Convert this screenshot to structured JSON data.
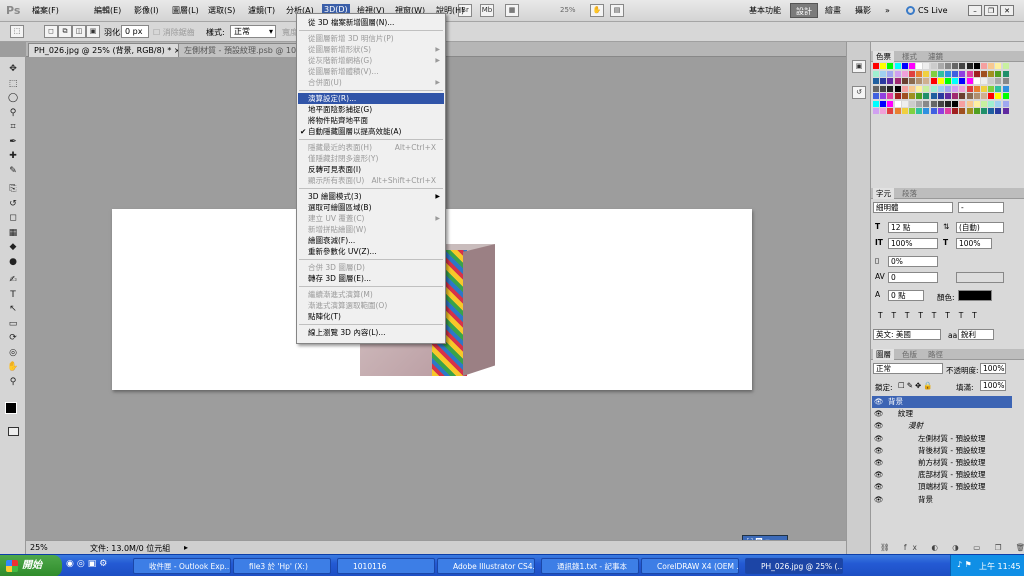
{
  "app": {
    "logo": "Ps"
  },
  "menubar": {
    "items": [
      "檔案(F)",
      "編輯(E)",
      "影像(I)",
      "圖層(L)",
      "選取(S)",
      "濾鏡(T)",
      "分析(A)",
      "3D(D)",
      "檢視(V)",
      "視窗(W)",
      "說明(H)"
    ],
    "active": "3D(D)",
    "toolbar_icons": [
      "Br",
      "Mb"
    ],
    "zoom": "25%",
    "workspaces": [
      "基本功能",
      "設計",
      "繪畫",
      "攝影"
    ],
    "workspace_selected": "設計",
    "more": "»",
    "cslive": "CS Live"
  },
  "options": {
    "feather_label": "羽化:",
    "feather_value": "0 px",
    "antialias_label": "消除鋸齒",
    "style_label": "樣式:",
    "style_value": "正常",
    "width_label": "寬度:"
  },
  "tabs": [
    {
      "label": "PH_026.jpg @ 25% (背景, RGB/8) *"
    },
    {
      "label": "左側材質 - 預設紋理.psb @ 10..."
    }
  ],
  "tab_close": "×",
  "tools": [
    "move-tool",
    "marquee-tool",
    "lasso-tool",
    "quick-select-tool",
    "crop-tool",
    "eyedropper-tool",
    "healing-tool",
    "brush-tool",
    "clone-tool",
    "history-brush-tool",
    "eraser-tool",
    "gradient-tool",
    "blur-tool",
    "dodge-tool",
    "pen-tool",
    "type-tool",
    "path-select-tool",
    "shape-tool",
    "3d-rotate-tool",
    "3d-orbit-tool",
    "hand-tool",
    "zoom-tool"
  ],
  "tool_glyphs": [
    "✥",
    "⬚",
    "◯",
    "⚲",
    "⌗",
    "✒",
    "✚",
    "✎",
    "⎘",
    "↺",
    "◻",
    "▦",
    "◆",
    "●",
    "✍",
    "T",
    "↖",
    "▭",
    "⟳",
    "◎",
    "✋",
    "⚲"
  ],
  "status": {
    "zoom": "25%",
    "doc": "文件: 13.0M/0 位元組"
  },
  "menu_3d": [
    {
      "label": "從 3D 檔案新增圖層(N)...",
      "enabled": true
    },
    {
      "sep": true
    },
    {
      "label": "從圖層新增 3D 明信片(P)",
      "enabled": false
    },
    {
      "label": "從圖層新增形狀(S)",
      "enabled": false,
      "submenu": true
    },
    {
      "label": "從灰階新增網格(G)",
      "enabled": false,
      "submenu": true
    },
    {
      "label": "從圖層新增體積(V)...",
      "enabled": false
    },
    {
      "label": "合併面(U)",
      "enabled": false,
      "submenu": true
    },
    {
      "sep": true
    },
    {
      "label": "演算設定(R)...",
      "enabled": true,
      "highlighted": true
    },
    {
      "label": "地平面陰影捕捉(G)",
      "enabled": true
    },
    {
      "label": "將物件貼齊地平面",
      "enabled": true
    },
    {
      "label": "自動隱藏圖層以提高效能(A)",
      "enabled": true,
      "checked": true
    },
    {
      "sep": true
    },
    {
      "label": "隱藏最近的表面(H)",
      "enabled": false,
      "shortcut": "Alt+Ctrl+X"
    },
    {
      "label": "僅隱藏封閉多邊形(Y)",
      "enabled": false
    },
    {
      "label": "反轉可見表面(I)",
      "enabled": true
    },
    {
      "label": "顯示所有表面(U)",
      "enabled": false,
      "shortcut": "Alt+Shift+Ctrl+X"
    },
    {
      "sep": true
    },
    {
      "label": "3D 繪圖模式(3)",
      "enabled": true,
      "submenu": true
    },
    {
      "label": "選取可繪圖區域(B)",
      "enabled": true
    },
    {
      "label": "建立 UV 覆蓋(C)",
      "enabled": false,
      "submenu": true
    },
    {
      "label": "新增拼貼繪圖(W)",
      "enabled": false
    },
    {
      "label": "繪圖衰減(F)...",
      "enabled": true
    },
    {
      "label": "重新參數化 UV(Z)...",
      "enabled": true
    },
    {
      "sep": true
    },
    {
      "label": "合併 3D 圖層(D)",
      "enabled": false
    },
    {
      "label": "轉存 3D 圖層(E)...",
      "enabled": true
    },
    {
      "sep": true
    },
    {
      "label": "繼續漸進式演算(M)",
      "enabled": false
    },
    {
      "label": "漸進式演算選取範圍(O)",
      "enabled": false
    },
    {
      "label": "點陣化(T)",
      "enabled": true
    },
    {
      "sep": true
    },
    {
      "label": "線上瀏覽 3D 內容(L)...",
      "enabled": true
    }
  ],
  "panels": {
    "color_tabs": [
      "色票",
      "樣式",
      "濾鏡"
    ],
    "char_tabs": [
      "字元",
      "段落"
    ],
    "font_family": "細明體",
    "font_style": "-",
    "font_size": "12 點",
    "leading": "(自動)",
    "vscale": "100%",
    "hscale": "100%",
    "tracking_pct": "0%",
    "kerning": "0",
    "baseline": "0 點",
    "color_label": "顏色:",
    "text_color": "#000000",
    "language": "英文: 美國",
    "aa_label": "aa",
    "antialias": "銳利",
    "layer_tabs": [
      "圖層",
      "色版",
      "路徑"
    ],
    "blend_mode": "正常",
    "opacity_label": "不透明度:",
    "opacity": "100%",
    "lock_label": "鎖定:",
    "fill_label": "填滿:",
    "fill": "100%",
    "layers": [
      {
        "name": "背景",
        "level": 0,
        "selected": true
      },
      {
        "name": "紋理",
        "level": 1
      },
      {
        "name": "漫射",
        "level": 2,
        "italic": true
      },
      {
        "name": "左側材質 - 預設紋理",
        "level": 3
      },
      {
        "name": "背後材質 - 預設紋理",
        "level": 3
      },
      {
        "name": "前方材質 - 預設紋理",
        "level": 3
      },
      {
        "name": "底部材質 - 預設紋理",
        "level": 3
      },
      {
        "name": "頂端材質 - 預設紋理",
        "level": 3
      },
      {
        "name": "背景",
        "level": 3
      }
    ]
  },
  "taskbar": {
    "start": "開始",
    "tasks": [
      "收件匣 - Outlook Exp...",
      "file3 於 'Hp' (X:)",
      "1010116",
      "Adobe Illustrator CS4...",
      "通訊錄1.txt - 記事本",
      "CorelDRAW X4 (OEM ...",
      "PH_026.jpg @ 25% (..."
    ],
    "active_task": 6,
    "clock": "上午 11:45"
  }
}
